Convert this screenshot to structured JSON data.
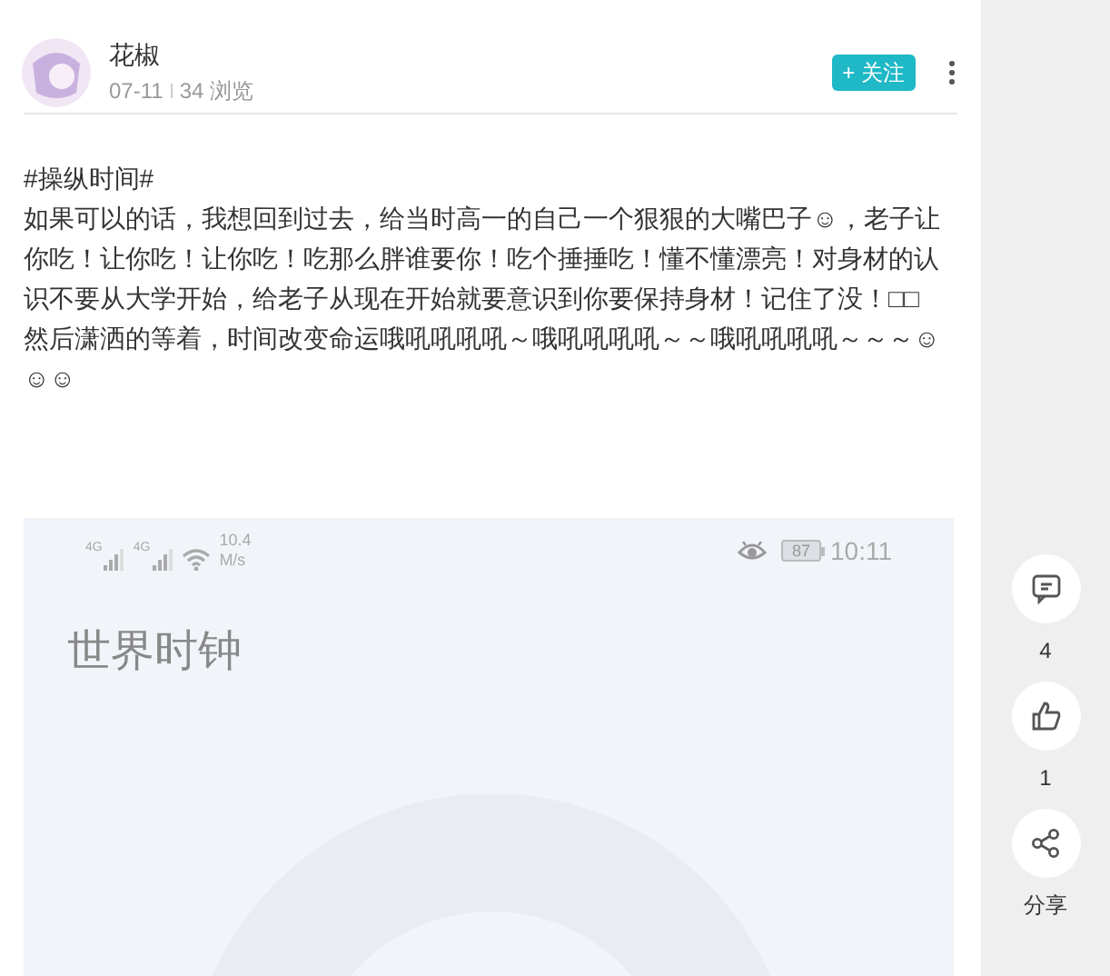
{
  "author": {
    "name": "花椒",
    "date": "07-11",
    "views": "34 浏览"
  },
  "follow_button": "+ 关注",
  "post": {
    "paragraphs": [
      "#操纵时间#",
      "如果可以的话，我想回到过去，给当时高一的自己一个狠狠的大嘴巴子☺，老子让你吃！让你吃！让你吃！吃那么胖谁要你！吃个捶捶吃！懂不懂漂亮！对身材的认识不要从大学开始，给老子从现在开始就要意识到你要保持身材！记住了没！□□",
      "然后潇洒的等着，时间改变命运哦吼吼吼吼～哦吼吼吼吼～～哦吼吼吼吼～～～☺☺☺"
    ]
  },
  "screenshot": {
    "status_bar": {
      "network_1": "4G",
      "network_2": "4G",
      "speed_value": "10.4",
      "speed_unit": "M/s",
      "battery": "87",
      "time": "10:11"
    },
    "title": "世界时钟"
  },
  "actions": [
    {
      "kind": "comment",
      "label": "4"
    },
    {
      "kind": "like",
      "label": "1"
    },
    {
      "kind": "share",
      "label": "分享"
    }
  ]
}
